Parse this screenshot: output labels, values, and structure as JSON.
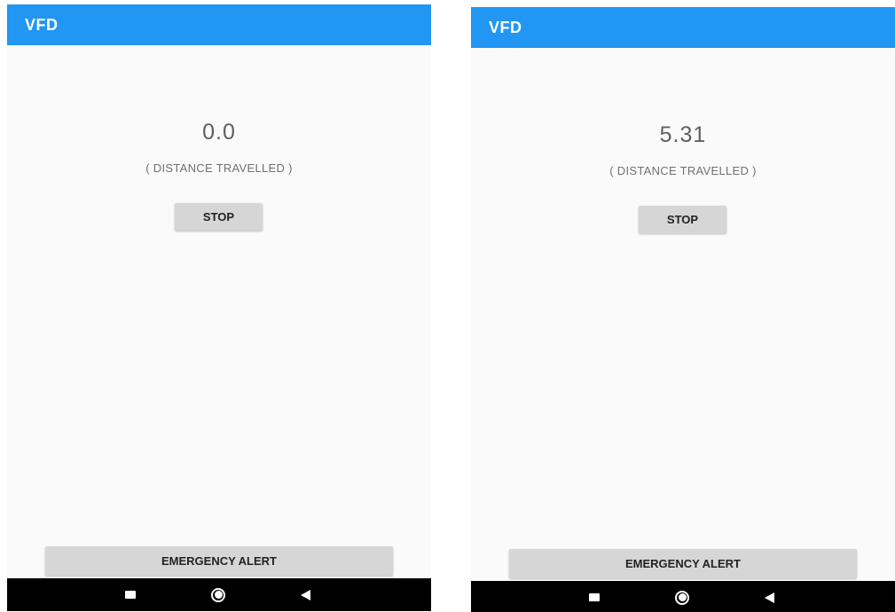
{
  "screens": [
    {
      "app_title": "VFD",
      "distance_value": "0.0",
      "distance_label": "( DISTANCE TRAVELLED )",
      "stop_button_label": "STOP",
      "emergency_button_label": "EMERGENCY ALERT"
    },
    {
      "app_title": "VFD",
      "distance_value": "5.31",
      "distance_label": "( DISTANCE TRAVELLED )",
      "stop_button_label": "STOP",
      "emergency_button_label": "EMERGENCY ALERT"
    }
  ],
  "navigation_bar": {
    "icons": [
      "recents-icon",
      "home-icon",
      "back-icon"
    ]
  },
  "colors": {
    "appbar": "#2196F3",
    "background": "#fafafa",
    "button": "#d6d6d6",
    "navbar": "#000000"
  }
}
